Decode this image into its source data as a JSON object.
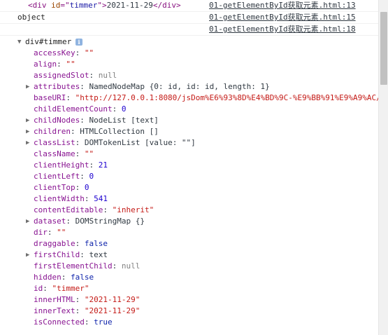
{
  "logs": [
    {
      "tag_open": "<div ",
      "attr_name": "id",
      "attr_eq": "=\"",
      "attr_value": "timmer",
      "attr_close": "\">",
      "text": "2021-11-29",
      "tag_close": "</div>",
      "source": "01-getElementById获取元素.html:13"
    },
    {
      "message": "object",
      "source": "01-getElementById获取元素.html:15"
    },
    {
      "message": "",
      "source": "01-getElementById获取元素.html:18"
    }
  ],
  "object_header": {
    "label": "div#timmer",
    "info_glyph": "i"
  },
  "properties": [
    {
      "key": "accessKey",
      "value": "\"\"",
      "type": "str",
      "expandable": false
    },
    {
      "key": "align",
      "value": "\"\"",
      "type": "str",
      "expandable": false
    },
    {
      "key": "assignedSlot",
      "value": "null",
      "type": "null",
      "expandable": false
    },
    {
      "key": "attributes",
      "value": "NamedNodeMap {0: id, id: id, length: 1}",
      "type": "obj",
      "expandable": true
    },
    {
      "key": "baseURI",
      "value": "\"http://127.0.0.1:8080/jsDom%E6%93%8D%E4%BD%9C-%E9%BB%91%E9%A9%AC/",
      "type": "str",
      "expandable": false
    },
    {
      "key": "childElementCount",
      "value": "0",
      "type": "num",
      "expandable": false
    },
    {
      "key": "childNodes",
      "value": "NodeList [text]",
      "type": "obj",
      "expandable": true
    },
    {
      "key": "children",
      "value": "HTMLCollection []",
      "type": "obj",
      "expandable": true
    },
    {
      "key": "classList",
      "value": "DOMTokenList [value: \"\"]",
      "type": "obj",
      "expandable": true
    },
    {
      "key": "className",
      "value": "\"\"",
      "type": "str",
      "expandable": false
    },
    {
      "key": "clientHeight",
      "value": "21",
      "type": "num",
      "expandable": false
    },
    {
      "key": "clientLeft",
      "value": "0",
      "type": "num",
      "expandable": false
    },
    {
      "key": "clientTop",
      "value": "0",
      "type": "num",
      "expandable": false
    },
    {
      "key": "clientWidth",
      "value": "541",
      "type": "num",
      "expandable": false
    },
    {
      "key": "contentEditable",
      "value": "\"inherit\"",
      "type": "str",
      "expandable": false
    },
    {
      "key": "dataset",
      "value": "DOMStringMap {}",
      "type": "obj",
      "expandable": true
    },
    {
      "key": "dir",
      "value": "\"\"",
      "type": "str",
      "expandable": false
    },
    {
      "key": "draggable",
      "value": "false",
      "type": "bool",
      "expandable": false
    },
    {
      "key": "firstChild",
      "value": "text",
      "type": "obj",
      "expandable": true
    },
    {
      "key": "firstElementChild",
      "value": "null",
      "type": "null",
      "expandable": false
    },
    {
      "key": "hidden",
      "value": "false",
      "type": "bool",
      "expandable": false
    },
    {
      "key": "id",
      "value": "\"timmer\"",
      "type": "str",
      "expandable": false
    },
    {
      "key": "innerHTML",
      "value": "\"2021-11-29\"",
      "type": "str",
      "expandable": false
    },
    {
      "key": "innerText",
      "value": "\"2021-11-29\"",
      "type": "str",
      "expandable": false
    },
    {
      "key": "isConnected",
      "value": "true",
      "type": "bool",
      "expandable": false
    }
  ],
  "glyphs": {
    "expanded": "▼",
    "collapsed": "▶",
    "separator": ": "
  }
}
